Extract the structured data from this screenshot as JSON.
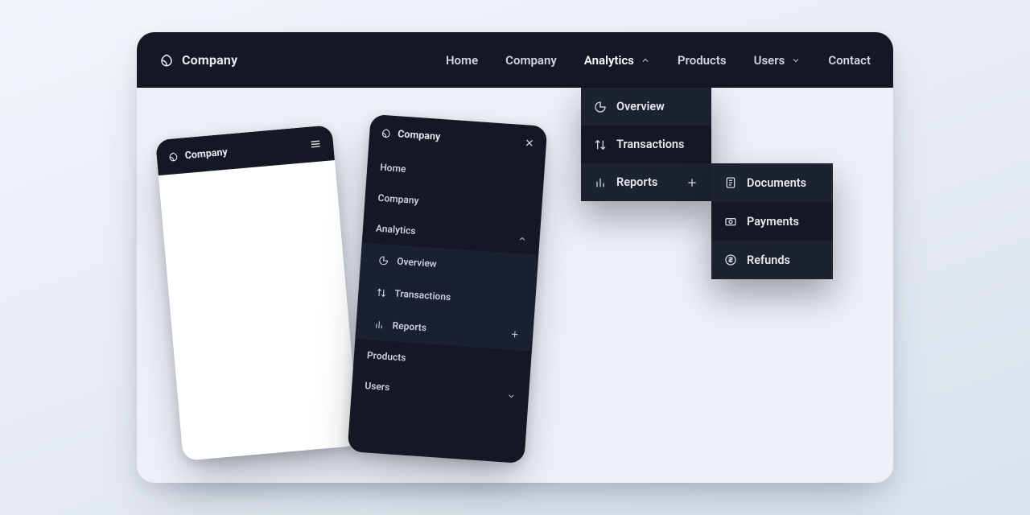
{
  "brand": {
    "name": "Company"
  },
  "nav": {
    "home": "Home",
    "company": "Company",
    "analytics": "Analytics",
    "products": "Products",
    "users": "Users",
    "contact": "Contact"
  },
  "analytics_menu": {
    "overview": "Overview",
    "transactions": "Transactions",
    "reports": "Reports"
  },
  "reports_menu": {
    "documents": "Documents",
    "payments": "Payments",
    "refunds": "Refunds"
  },
  "mobile_menu": {
    "home": "Home",
    "company": "Company",
    "analytics": "Analytics",
    "overview": "Overview",
    "transactions": "Transactions",
    "reports": "Reports",
    "products": "Products",
    "users": "Users"
  }
}
